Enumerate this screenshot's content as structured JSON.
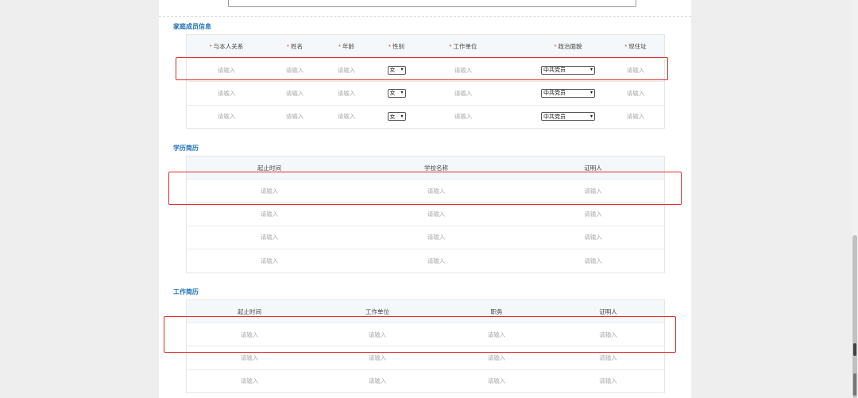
{
  "family": {
    "title": "家庭成员信息",
    "headers": [
      {
        "label": "与本人关系",
        "required": "*"
      },
      {
        "label": "姓名",
        "required": "*"
      },
      {
        "label": "年龄",
        "required": "*"
      },
      {
        "label": "性别",
        "required": "*"
      },
      {
        "label": "工作单位",
        "required": "*"
      },
      {
        "label": "政治面貌",
        "required": "*"
      },
      {
        "label": "现住址",
        "required": "*"
      }
    ],
    "placeholder": "请输入",
    "gender_value": "女",
    "political_value": "中共党员"
  },
  "education": {
    "title": "学历简历",
    "headers": [
      "起止时间",
      "学校名称",
      "证明人"
    ],
    "placeholder": "请输入"
  },
  "work": {
    "title": "工作简历",
    "headers": [
      "起止时间",
      "工作单位",
      "职务",
      "证明人"
    ],
    "placeholder": "请输入"
  },
  "icons": {
    "select_arrow": "chevron-down-icon"
  }
}
